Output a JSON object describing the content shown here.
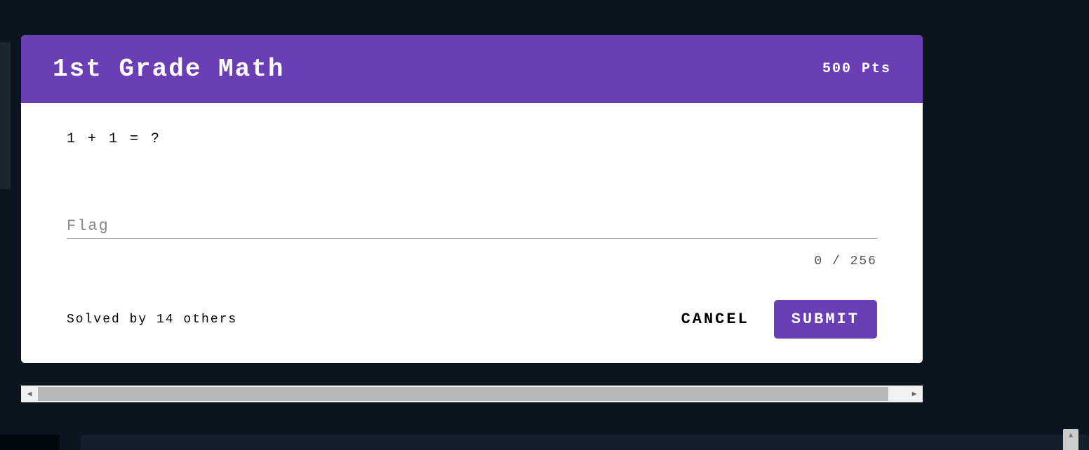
{
  "challenge": {
    "title": "1st Grade Math",
    "points_label": "500 Pts",
    "question": "1 + 1 = ?",
    "flag_input_placeholder": "Flag",
    "char_counter": "0 / 256",
    "solved_by": "Solved by 14 others"
  },
  "buttons": {
    "cancel": "CANCEL",
    "submit": "SUBMIT"
  }
}
